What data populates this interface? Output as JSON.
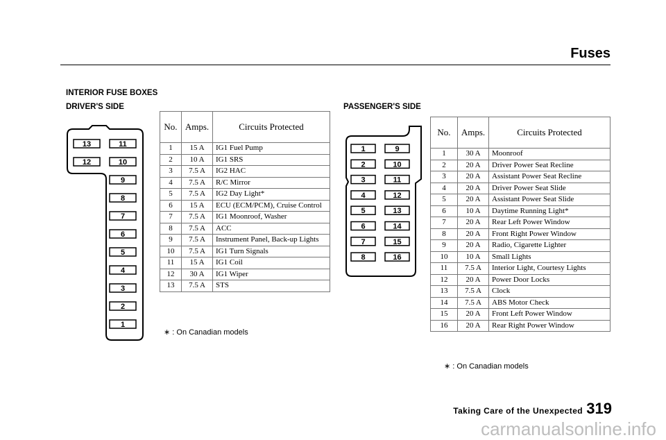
{
  "header": {
    "title": "Fuses"
  },
  "section_title": "INTERIOR FUSE BOXES",
  "driver": {
    "label": "DRIVER'S SIDE",
    "diagram_fuses": [
      "13",
      "11",
      "12",
      "10",
      "9",
      "8",
      "7",
      "6",
      "5",
      "4",
      "3",
      "2",
      "1"
    ],
    "columns": [
      "No.",
      "Amps.",
      "Circuits Protected"
    ],
    "rows": [
      [
        "1",
        "15 A",
        "IG1 Fuel Pump"
      ],
      [
        "2",
        "10 A",
        "IG1 SRS"
      ],
      [
        "3",
        "7.5 A",
        "IG2 HAC"
      ],
      [
        "4",
        "7.5 A",
        "R/C Mirror"
      ],
      [
        "5",
        "7.5 A",
        "IG2 Day Light*"
      ],
      [
        "6",
        "15 A",
        "ECU (ECM/PCM), Cruise Control"
      ],
      [
        "7",
        "7.5 A",
        "IG1 Moonroof, Washer"
      ],
      [
        "8",
        "7.5 A",
        "ACC"
      ],
      [
        "9",
        "7.5 A",
        "Instrument Panel, Back-up Lights"
      ],
      [
        "10",
        "7.5 A",
        "IG1 Turn Signals"
      ],
      [
        "11",
        "15 A",
        "IG1 Coil"
      ],
      [
        "12",
        "30 A",
        "IG1 Wiper"
      ],
      [
        "13",
        "7.5 A",
        "STS"
      ]
    ],
    "note": "∗ : On Canadian models"
  },
  "passenger": {
    "label": "PASSENGER'S SIDE",
    "diagram_fuses": [
      "1",
      "2",
      "3",
      "4",
      "5",
      "6",
      "7",
      "8",
      "9",
      "10",
      "11",
      "12",
      "13",
      "14",
      "15",
      "16"
    ],
    "columns": [
      "No.",
      "Amps.",
      "Circuits Protected"
    ],
    "rows": [
      [
        "1",
        "30 A",
        "Moonroof"
      ],
      [
        "2",
        "20 A",
        "Driver Power Seat Recline"
      ],
      [
        "3",
        "20 A",
        "Assistant Power Seat Recline"
      ],
      [
        "4",
        "20 A",
        "Driver Power Seat Slide"
      ],
      [
        "5",
        "20 A",
        "Assistant Power Seat Slide"
      ],
      [
        "6",
        "10 A",
        "Daytime Running Light*"
      ],
      [
        "7",
        "20 A",
        "Rear Left Power Window"
      ],
      [
        "8",
        "20 A",
        "Front Right Power Window"
      ],
      [
        "9",
        "20 A",
        "Radio, Cigarette Lighter"
      ],
      [
        "10",
        "10 A",
        "Small Lights"
      ],
      [
        "11",
        "7.5 A",
        "Interior Light, Courtesy Lights"
      ],
      [
        "12",
        "20 A",
        "Power Door Locks"
      ],
      [
        "13",
        "7.5 A",
        "Clock"
      ],
      [
        "14",
        "7.5 A",
        "ABS Motor Check"
      ],
      [
        "15",
        "20 A",
        "Front Left Power Window"
      ],
      [
        "16",
        "20 A",
        "Rear Right Power Window"
      ]
    ],
    "note": "∗ : On Canadian models"
  },
  "footer": {
    "section": "Taking Care of the Unexpected",
    "page": "319"
  },
  "watermark": "carmanualsonline.info"
}
